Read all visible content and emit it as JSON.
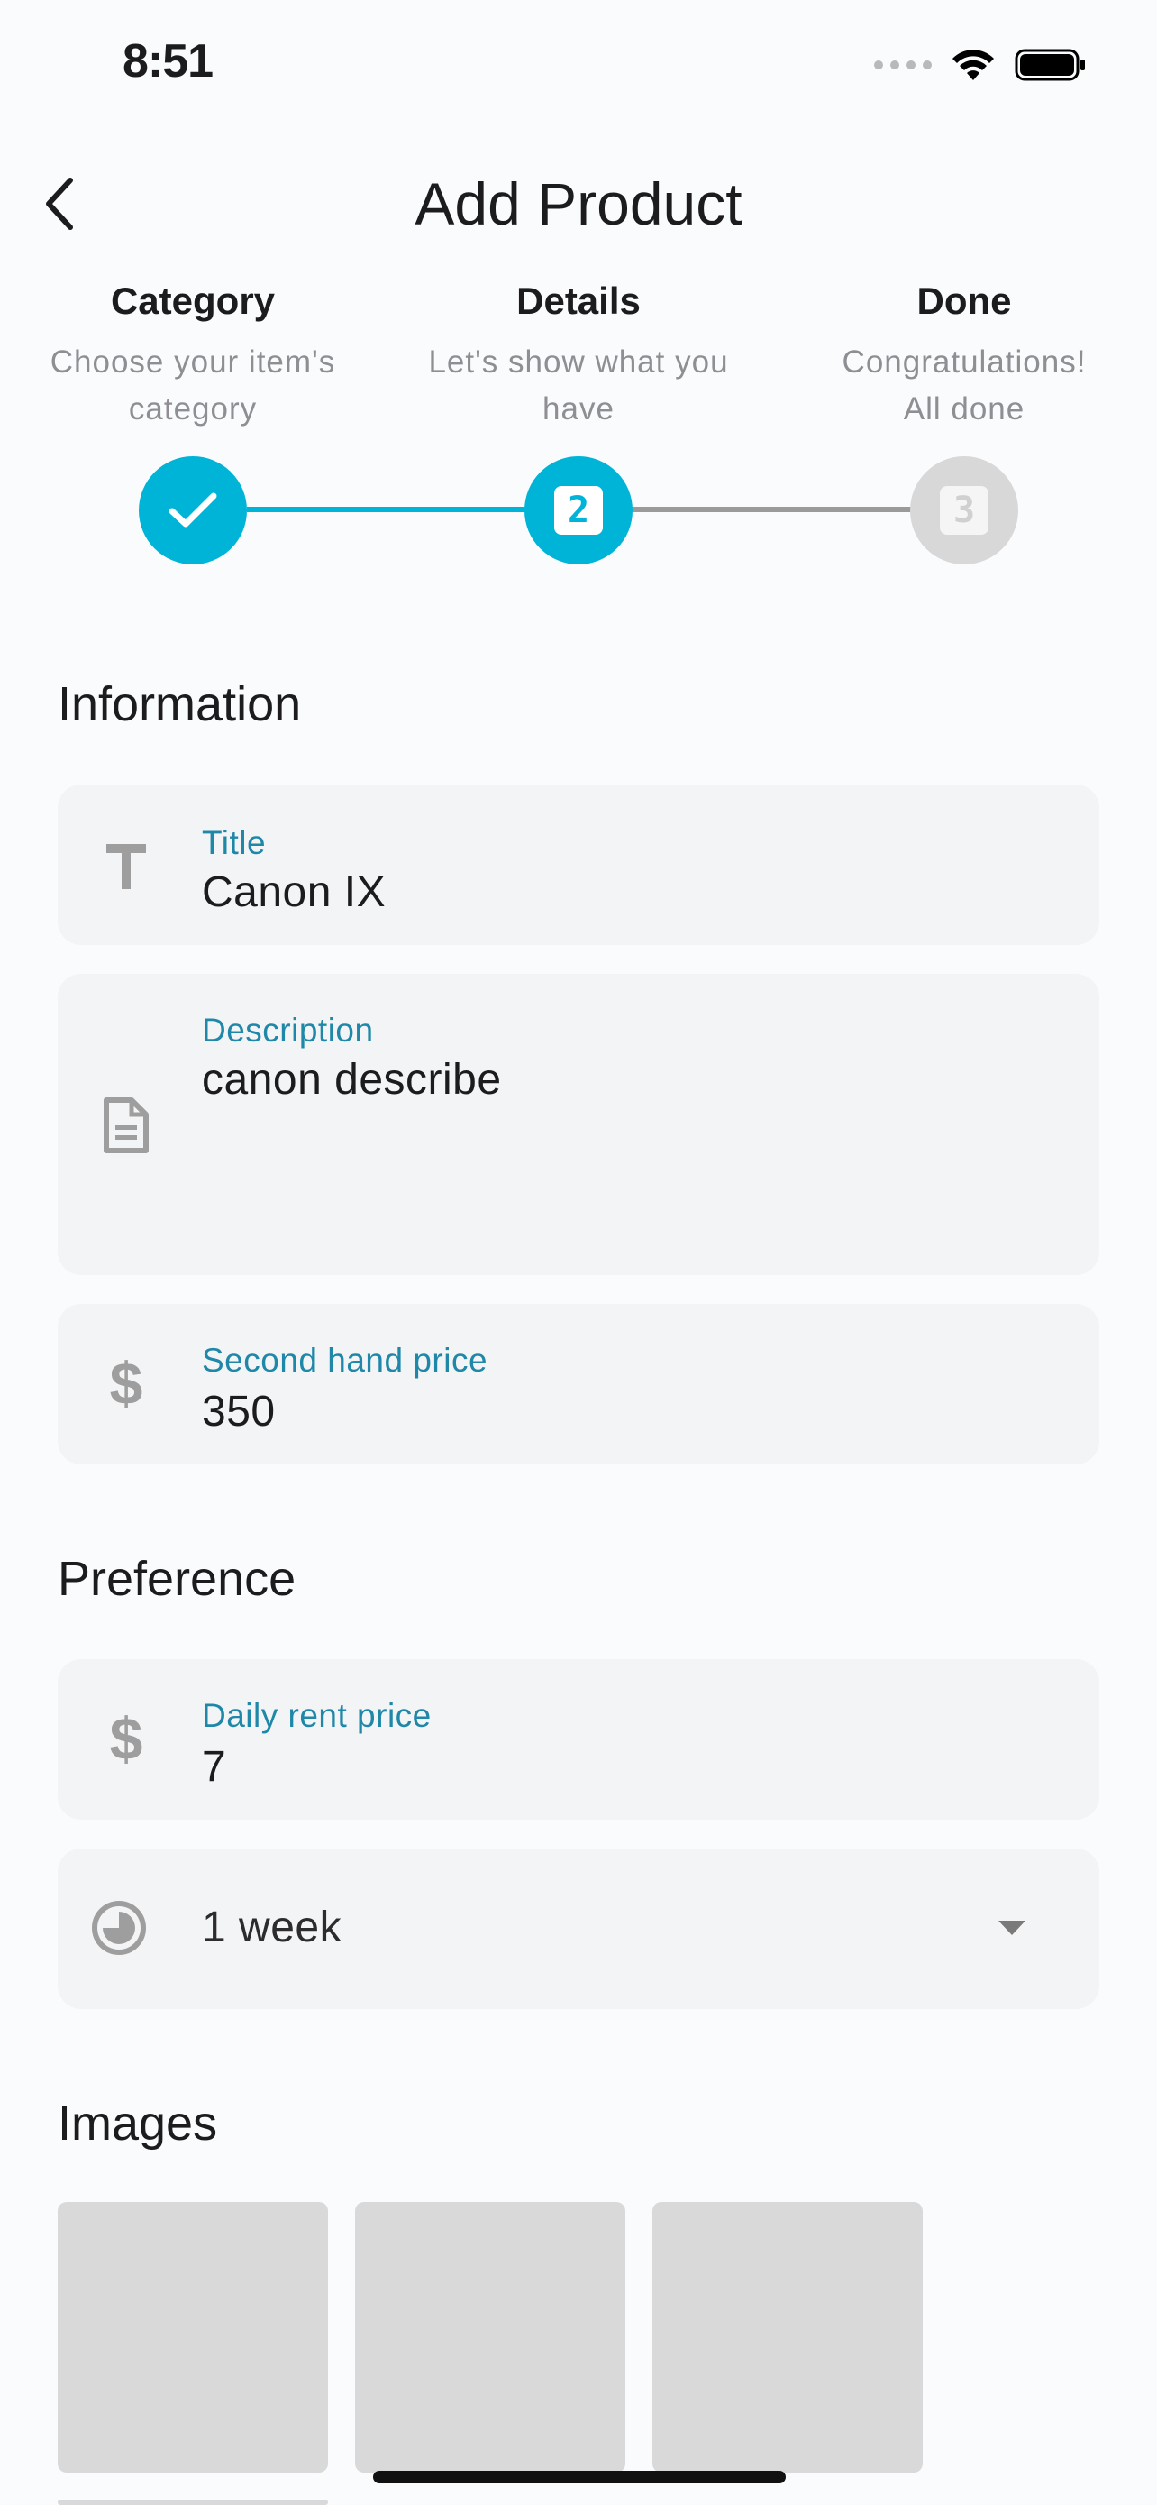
{
  "status_bar": {
    "time": "8:51"
  },
  "header": {
    "title": "Add Product"
  },
  "stepper": {
    "steps": [
      {
        "title": "Category",
        "subtitle_line1": "Choose your item's",
        "subtitle_line2": "category",
        "state": "done"
      },
      {
        "title": "Details",
        "subtitle_line1": "Let's show what you",
        "subtitle_line2": "have",
        "state": "active",
        "number": "2"
      },
      {
        "title": "Done",
        "subtitle_line1": "Congratulations!",
        "subtitle_line2": "All done",
        "state": "pending",
        "number": "3"
      }
    ],
    "colors": {
      "active": "#00b4d8",
      "pending": "#d8d8d8",
      "line_pending": "#9a9a9a"
    }
  },
  "information": {
    "heading": "Information",
    "title_field": {
      "label": "Title",
      "value": "Canon IX",
      "icon": "text-icon"
    },
    "description_field": {
      "label": "Description",
      "value": "canon describe",
      "icon": "document-icon"
    },
    "second_hand_price_field": {
      "label": "Second hand price",
      "value": "350",
      "icon": "dollar-icon"
    }
  },
  "preference": {
    "heading": "Preference",
    "daily_rent_field": {
      "label": "Daily rent price",
      "value": "7",
      "icon": "dollar-icon"
    },
    "duration_select": {
      "value": "1 week",
      "icon": "clock-icon"
    }
  },
  "images": {
    "heading": "Images"
  }
}
